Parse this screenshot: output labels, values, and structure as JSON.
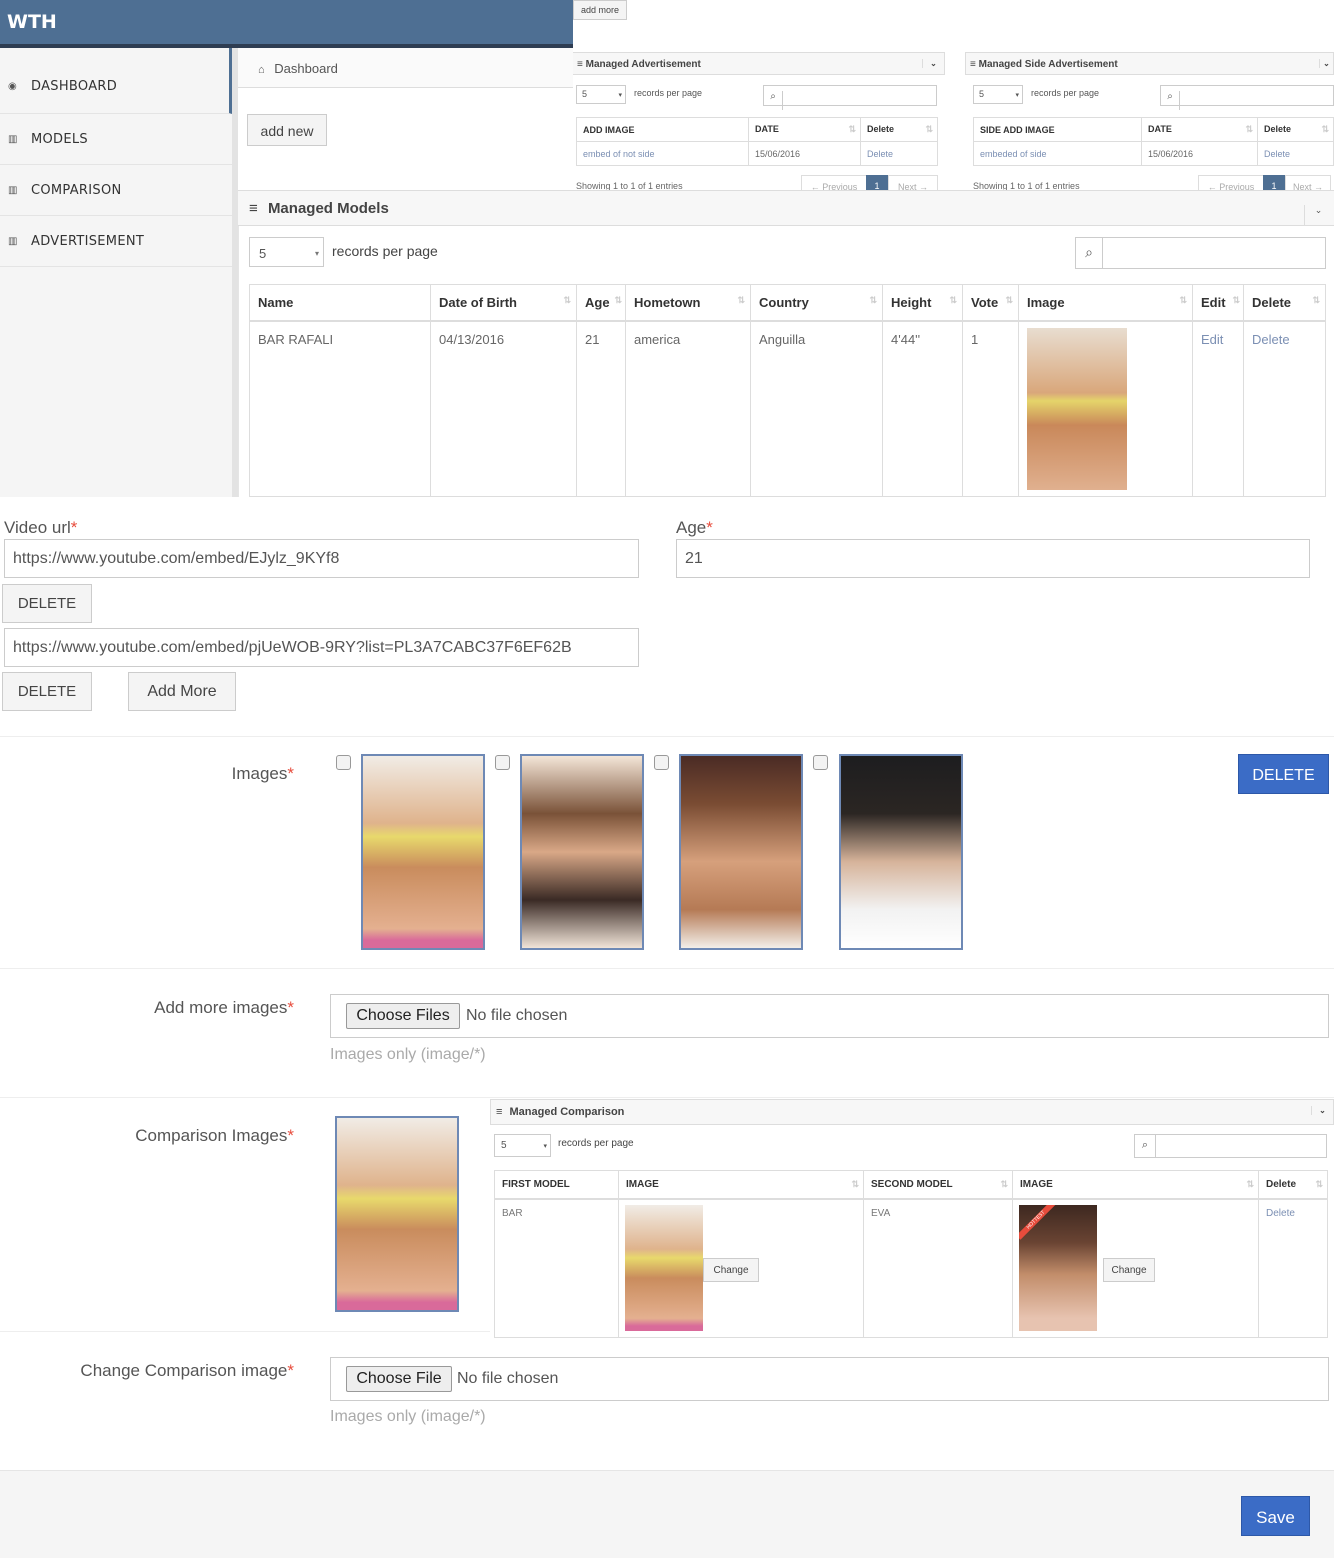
{
  "app": {
    "title": "WTH"
  },
  "sidebar": {
    "items": [
      {
        "label": "DASHBOARD",
        "icon": "dashboard-icon"
      },
      {
        "label": "MODELS",
        "icon": "bar-chart-icon"
      },
      {
        "label": "COMPARISON",
        "icon": "bar-chart-icon"
      },
      {
        "label": "ADVERTISEMENT",
        "icon": "bar-chart-icon"
      }
    ]
  },
  "breadcrumb": {
    "home": "Dashboard"
  },
  "add_new_label": "add new",
  "add_more_label": "add more",
  "ads": {
    "title": "Managed Advertisement",
    "per_page": "5",
    "per_page_label": "records per page",
    "columns": [
      "ADD IMAGE",
      "DATE",
      "Delete"
    ],
    "rows": [
      {
        "image": "embed of not side",
        "date": "15/06/2016",
        "delete": "Delete"
      }
    ],
    "showing": "Showing 1 to 1 of 1 entries",
    "prev": "← Previous",
    "page": "1",
    "next": "Next →"
  },
  "side_ads": {
    "title": "Managed Side Advertisement",
    "per_page": "5",
    "per_page_label": "records per page",
    "columns": [
      "SIDE ADD IMAGE",
      "DATE",
      "Delete"
    ],
    "rows": [
      {
        "image": "embeded of side",
        "date": "15/06/2016",
        "delete": "Delete"
      }
    ],
    "showing": "Showing 1 to 1 of 1 entries",
    "prev": "← Previous",
    "page": "1",
    "next": "Next →"
  },
  "models": {
    "title": "Managed Models",
    "per_page": "5",
    "per_page_label": "records per page",
    "columns": [
      "Name",
      "Date of Birth",
      "Age",
      "Hometown",
      "Country",
      "Height",
      "Vote",
      "Image",
      "Edit",
      "Delete"
    ],
    "rows": [
      {
        "name": "BAR RAFALI",
        "dob": "04/13/2016",
        "age": "21",
        "hometown": "america",
        "country": "Anguilla",
        "height": "4'44''",
        "vote": "1",
        "edit": "Edit",
        "delete": "Delete"
      }
    ]
  },
  "form": {
    "video_label": "Video url",
    "videos": [
      "https://www.youtube.com/embed/EJylz_9KYf8",
      "https://www.youtube.com/embed/pjUeWOB-9RY?list=PL3A7CABC37F6EF62B"
    ],
    "delete_label": "DELETE",
    "add_more_label": "Add More",
    "age_label": "Age",
    "age_value": "21",
    "images_label": "Images",
    "images_delete_label": "DELETE",
    "add_images_label": "Add more images",
    "choose_files": "Choose Files",
    "no_file": "No file chosen",
    "images_hint": "Images only (image/*)",
    "comparison_label": "Comparison Images",
    "change_comparison_label": "Change Comparison image",
    "choose_file": "Choose File",
    "save_label": "Save"
  },
  "comparison": {
    "title": "Managed Comparison",
    "per_page": "5",
    "per_page_label": "records per page",
    "columns": [
      "FIRST MODEL",
      "IMAGE",
      "SECOND MODEL",
      "IMAGE",
      "Delete"
    ],
    "rows": [
      {
        "first": "BAR",
        "second": "EVA",
        "change": "Change",
        "delete": "Delete",
        "badge": "HOTTEST"
      }
    ]
  }
}
